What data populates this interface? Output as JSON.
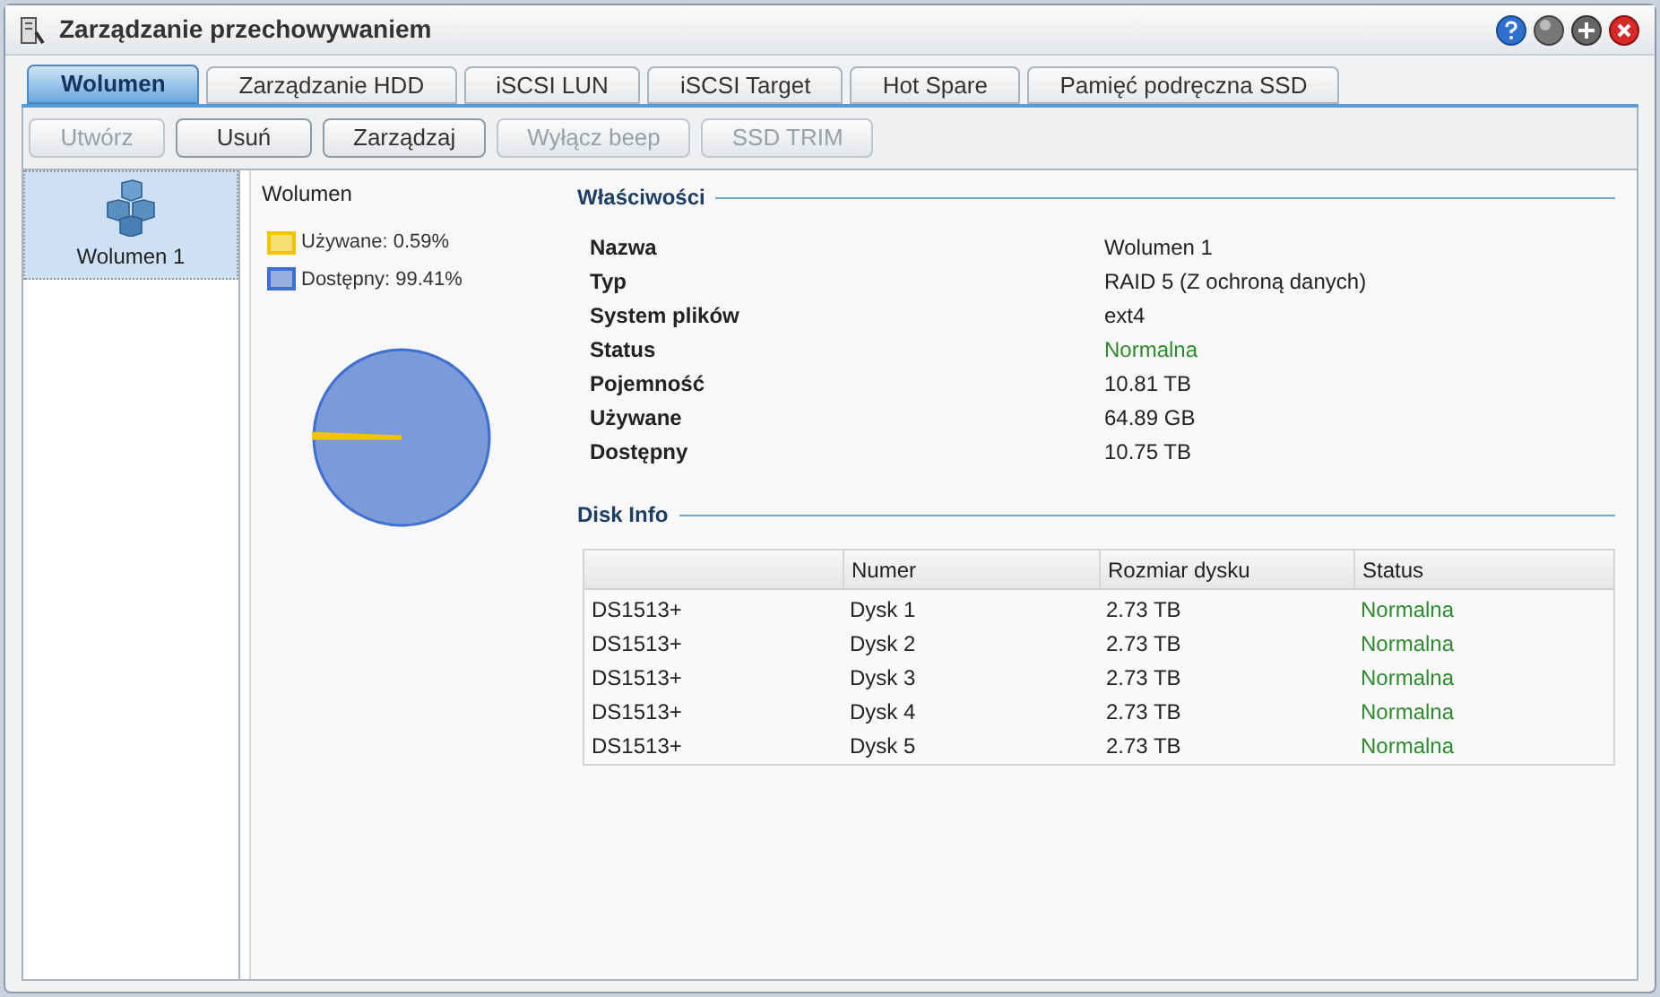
{
  "window": {
    "title": "Zarządzanie przechowywaniem"
  },
  "tabs": [
    {
      "label": "Wolumen",
      "selected": true
    },
    {
      "label": "Zarządzanie HDD",
      "selected": false
    },
    {
      "label": "iSCSI LUN",
      "selected": false
    },
    {
      "label": "iSCSI Target",
      "selected": false
    },
    {
      "label": "Hot Spare",
      "selected": false
    },
    {
      "label": "Pamięć podręczna SSD",
      "selected": false
    }
  ],
  "toolbar": [
    {
      "label": "Utwórz",
      "disabled": true
    },
    {
      "label": "Usuń",
      "disabled": false
    },
    {
      "label": "Zarządzaj",
      "disabled": false
    },
    {
      "label": "Wyłącz beep",
      "disabled": true
    },
    {
      "label": "SSD TRIM",
      "disabled": true
    }
  ],
  "sidebar": {
    "items": [
      {
        "label": "Wolumen 1",
        "selected": true
      }
    ]
  },
  "volume_chart": {
    "title": "Wolumen",
    "legend": [
      {
        "label": "Używane: 0.59%",
        "color": "#f5c400"
      },
      {
        "label": "Dostępny: 99.41%",
        "color": "#3f6fd0"
      }
    ],
    "chart_data": {
      "type": "pie",
      "values": [
        0.59,
        99.41
      ]
    }
  },
  "properties": {
    "title": "Właściwości",
    "rows": [
      {
        "name": "Nazwa",
        "value": "Wolumen 1",
        "kind": "text"
      },
      {
        "name": "Typ",
        "value": "RAID 5 (Z ochroną danych)",
        "kind": "text"
      },
      {
        "name": "System plików",
        "value": "ext4",
        "kind": "text"
      },
      {
        "name": "Status",
        "value": "Normalna",
        "kind": "status"
      },
      {
        "name": "Pojemność",
        "value": "10.81 TB",
        "kind": "text"
      },
      {
        "name": "Używane",
        "value": "64.89 GB",
        "kind": "text"
      },
      {
        "name": "Dostępny",
        "value": "10.75 TB",
        "kind": "text"
      }
    ]
  },
  "disk_info": {
    "title": "Disk Info",
    "columns": [
      {
        "kind": "text"
      },
      {
        "label": "Numer",
        "kind": "text"
      },
      {
        "label": "Rozmiar dysku",
        "kind": "text"
      },
      {
        "label": "Status",
        "kind": "status"
      }
    ],
    "rows": [
      [
        "DS1513+",
        "Dysk 1",
        "2.73 TB",
        "Normalna"
      ],
      [
        "DS1513+",
        "Dysk 2",
        "2.73 TB",
        "Normalna"
      ],
      [
        "DS1513+",
        "Dysk 3",
        "2.73 TB",
        "Normalna"
      ],
      [
        "DS1513+",
        "Dysk 4",
        "2.73 TB",
        "Normalna"
      ],
      [
        "DS1513+",
        "Dysk 5",
        "2.73 TB",
        "Normalna"
      ]
    ]
  }
}
